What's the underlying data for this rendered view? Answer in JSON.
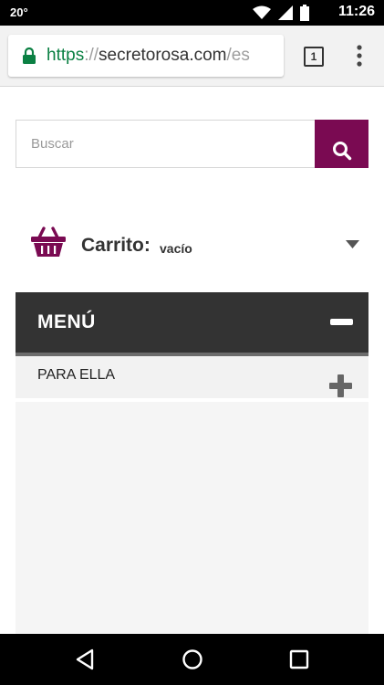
{
  "status_bar": {
    "temperature": "20°",
    "time": "11:26"
  },
  "browser": {
    "url_scheme": "https",
    "url_separator": "://",
    "url_host": "secretorosa.com",
    "url_path": "/es",
    "tab_count": "1"
  },
  "search": {
    "placeholder": "Buscar",
    "value": ""
  },
  "cart": {
    "label": "Carrito:",
    "status": "vacío"
  },
  "menu": {
    "title": "MENÚ",
    "items": [
      {
        "label": "PARA ELLA"
      }
    ]
  },
  "icons": {
    "lock": "lock-icon",
    "search": "search-icon",
    "cart": "basket-icon",
    "collapse": "minus-icon",
    "expand": "plus-icon",
    "overflow": "more-vertical-icon"
  },
  "colors": {
    "accent": "#7a0a52",
    "menu_header": "#333333",
    "url_secure": "#0b8043"
  }
}
